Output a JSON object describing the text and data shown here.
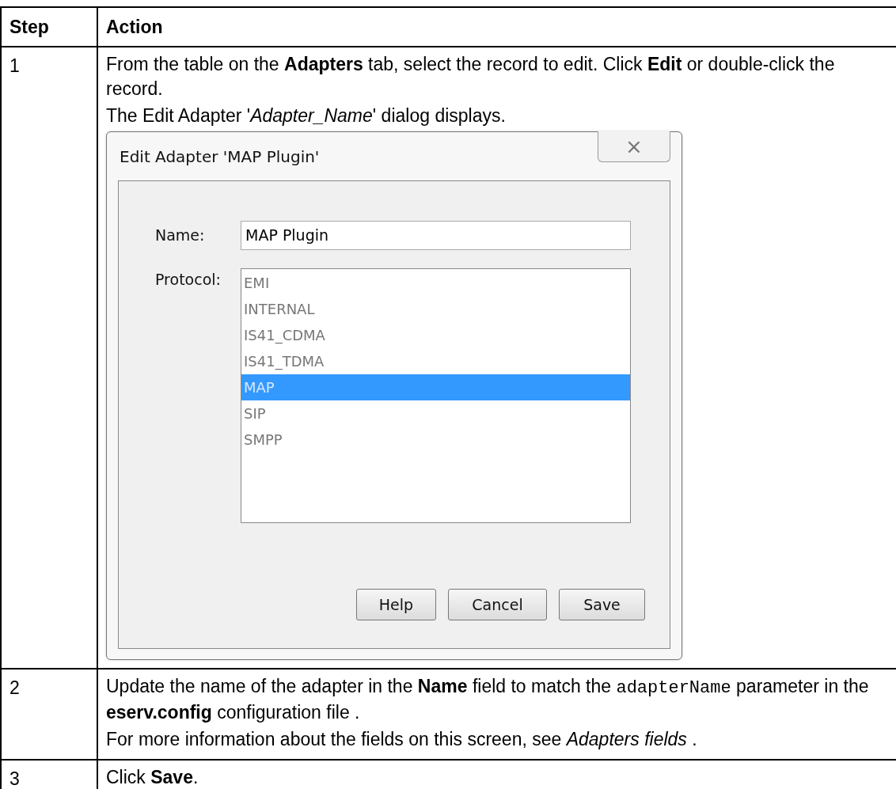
{
  "table": {
    "columns": [
      "Step",
      "Action"
    ],
    "rows": [
      {
        "step": "1",
        "paragraphs": [
          {
            "parts": [
              {
                "text": "From the table on the **Adapters** tab, select the record to edit. Click **Edit** or double-click the record.",
                "code": false
              }
            ]
          },
          {
            "parts": [
              {
                "text": "The Edit Adapter '*Adapter_Name*' dialog displays.",
                "code": false
              }
            ]
          }
        ],
        "dialog": {
          "title": "Edit Adapter 'MAP Plugin'",
          "close": "⨯",
          "name_label": "Name:",
          "name_value": "MAP Plugin",
          "protocol_label": "Protocol:",
          "protocols": [
            {
              "label": "EMI",
              "selected": false
            },
            {
              "label": "INTERNAL",
              "selected": false
            },
            {
              "label": "IS41_CDMA",
              "selected": false
            },
            {
              "label": "IS41_TDMA",
              "selected": false
            },
            {
              "label": "MAP",
              "selected": true
            },
            {
              "label": "SIP",
              "selected": false
            },
            {
              "label": "SMPP",
              "selected": false
            }
          ],
          "buttons": [
            "Help",
            "Cancel",
            "Save"
          ]
        }
      },
      {
        "step": "2",
        "paragraphs": [
          {
            "parts": [
              {
                "text": "Update the name of the adapter in the **Name** field to match the ",
                "code": false
              },
              {
                "text": "adapterName",
                "code": true
              },
              {
                "text": " parameter in the **eserv.config** configuration file .",
                "code": false
              }
            ]
          },
          {
            "parts": [
              {
                "text": "For more information about the fields on this screen, see *Adapters fields* .",
                "code": false
              }
            ]
          }
        ]
      },
      {
        "step": "3",
        "paragraphs": [
          {
            "parts": [
              {
                "text": "Click **Save**.",
                "code": false
              }
            ]
          }
        ]
      }
    ]
  }
}
